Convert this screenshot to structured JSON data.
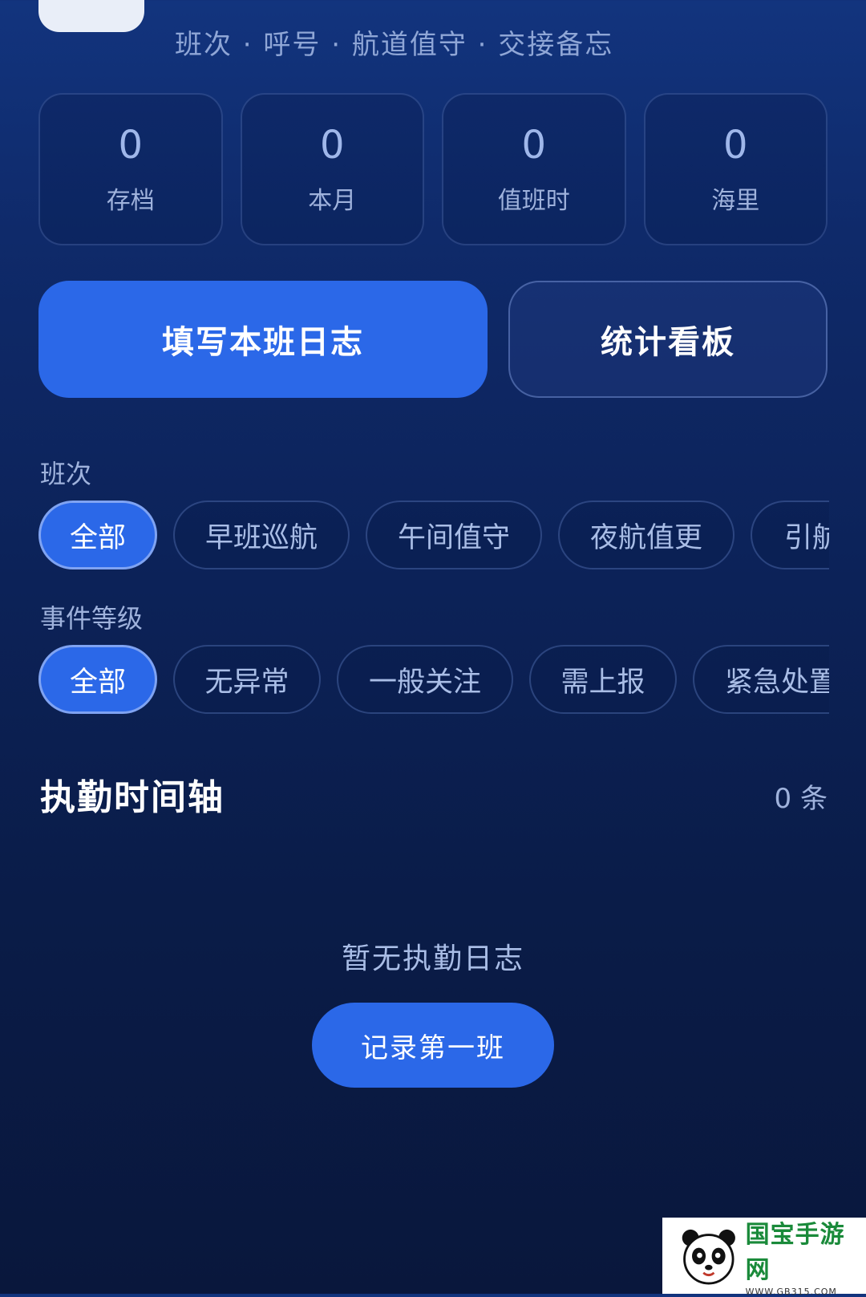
{
  "header": {
    "subtitle": "班次 · 呼号 · 航道值守 · 交接备忘"
  },
  "stats": [
    {
      "value": "0",
      "label": "存档"
    },
    {
      "value": "0",
      "label": "本月"
    },
    {
      "value": "0",
      "label": "值班时"
    },
    {
      "value": "0",
      "label": "海里"
    }
  ],
  "actions": {
    "primary_label": "填写本班日志",
    "secondary_label": "统计看板"
  },
  "filters": {
    "shift": {
      "label": "班次",
      "chips": [
        "全部",
        "早班巡航",
        "午间值守",
        "夜航值更",
        "引航"
      ],
      "selected": "全部"
    },
    "severity": {
      "label": "事件等级",
      "chips": [
        "全部",
        "无异常",
        "一般关注",
        "需上报",
        "紧急处置"
      ],
      "selected": "全部"
    }
  },
  "timeline": {
    "title": "执勤时间轴",
    "count": "0 条"
  },
  "empty_state": {
    "message": "暂无执勤日志",
    "button_label": "记录第一班"
  },
  "watermark": {
    "name": "国宝手游网",
    "url": "WWW.GB315.COM"
  },
  "colors": {
    "accent": "#2b68e8",
    "background_top": "#12347e",
    "background_bottom": "#09173c"
  }
}
